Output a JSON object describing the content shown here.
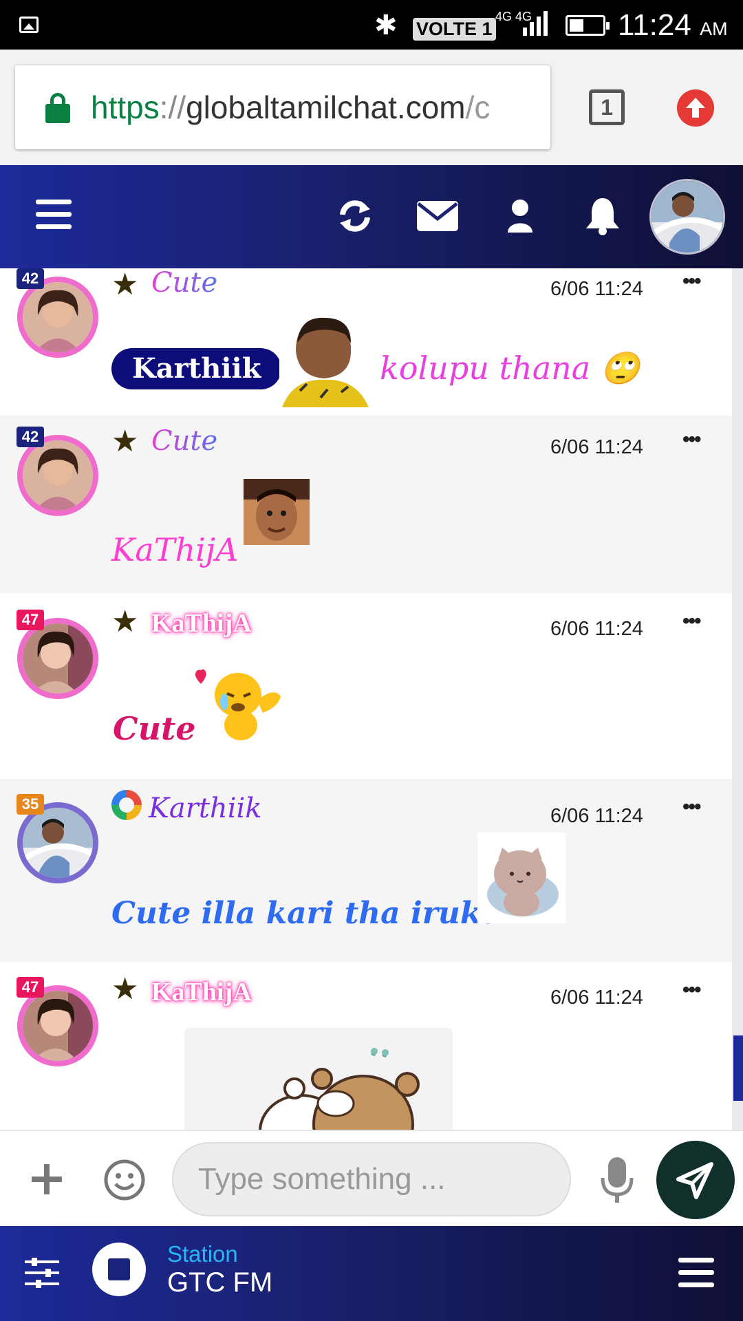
{
  "status_bar": {
    "time": "11:24",
    "ampm": "AM",
    "volte": "VOLTE 1",
    "network": "4G 4G",
    "sim": "1"
  },
  "browser": {
    "url_scheme": "https",
    "url_sep": "://",
    "url_host": "globaltamilchat.com",
    "url_rest": "/c",
    "tab_count": "1"
  },
  "messages": [
    {
      "user": "Cute",
      "level": "42",
      "time": "6/06 11:24",
      "mention": "Karthiik",
      "text": "kolupu thana",
      "emoji": "🙄",
      "text_color": "#e83fe0"
    },
    {
      "user": "Cute",
      "level": "42",
      "time": "6/06 11:24",
      "text": "KaThijA",
      "text_color": "#ff3cd4"
    },
    {
      "user": "KaThijA",
      "level": "47",
      "time": "6/06 11:24",
      "text": "Cute",
      "text_color": "#d6146a"
    },
    {
      "user": "Karthiik",
      "level": "35",
      "time": "6/06 11:24",
      "text": "Cute illa kari tha iruku",
      "text_color": "#2f6bf0"
    },
    {
      "user": "KaThijA",
      "level": "47",
      "time": "6/06 11:24"
    }
  ],
  "composer": {
    "placeholder": "Type something ..."
  },
  "radio": {
    "label": "Station",
    "name": "GTC FM"
  },
  "colors": {
    "header_start": "#1d2a9a",
    "header_end": "#0f0f35",
    "avatar_ring_pink": "#f06ccc",
    "avatar_ring_purple": "#7a6bd0",
    "send_button": "#11302b",
    "station_label": "#29b6f6"
  }
}
